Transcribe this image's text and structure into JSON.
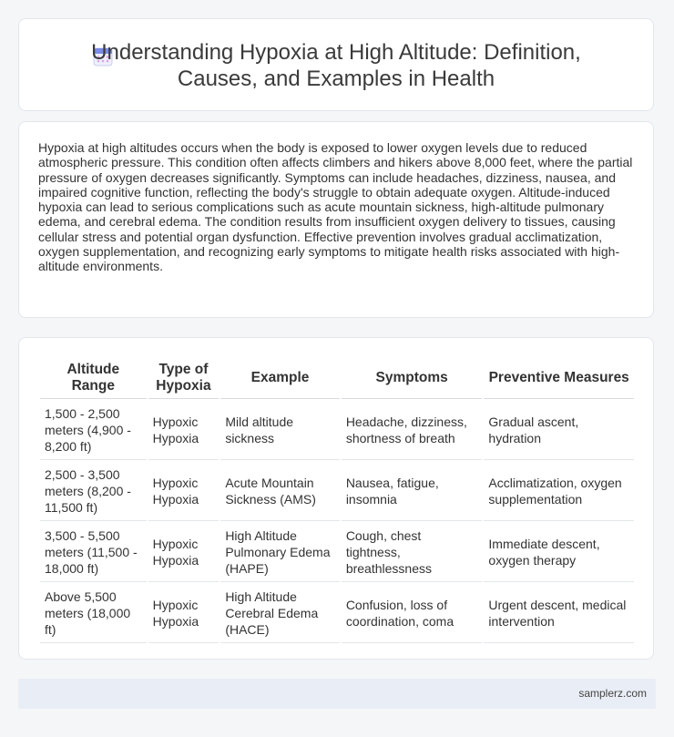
{
  "header": {
    "icon": "calendar-icon",
    "title": "Understanding Hypoxia at High Altitude: Definition, Causes, and Examples in Health"
  },
  "intro": {
    "text": "Hypoxia at high altitudes occurs when the body is exposed to lower oxygen levels due to reduced atmospheric pressure. This condition often affects climbers and hikers above 8,000 feet, where the partial pressure of oxygen decreases significantly. Symptoms can include headaches, dizziness, nausea, and impaired cognitive function, reflecting the body's struggle to obtain adequate oxygen. Altitude-induced hypoxia can lead to serious complications such as acute mountain sickness, high-altitude pulmonary edema, and cerebral edema. The condition results from insufficient oxygen delivery to tissues, causing cellular stress and potential organ dysfunction. Effective prevention involves gradual acclimatization, oxygen supplementation, and recognizing early symptoms to mitigate health risks associated with high-altitude environments."
  },
  "table": {
    "headers": [
      "Altitude Range",
      "Type of Hypoxia",
      "Example",
      "Symptoms",
      "Preventive Measures"
    ],
    "rows": [
      [
        "1,500 - 2,500 meters (4,900 - 8,200 ft)",
        "Hypoxic Hypoxia",
        "Mild altitude sickness",
        "Headache, dizziness, shortness of breath",
        "Gradual ascent, hydration"
      ],
      [
        "2,500 - 3,500 meters (8,200 - 11,500 ft)",
        "Hypoxic Hypoxia",
        "Acute Mountain Sickness (AMS)",
        "Nausea, fatigue, insomnia",
        "Acclimatization, oxygen supplementation"
      ],
      [
        "3,500 - 5,500 meters (11,500 - 18,000 ft)",
        "Hypoxic Hypoxia",
        "High Altitude Pulmonary Edema (HAPE)",
        "Cough, chest tightness, breathlessness",
        "Immediate descent, oxygen therapy"
      ],
      [
        "Above 5,500 meters (18,000 ft)",
        "Hypoxic Hypoxia",
        "High Altitude Cerebral Edema (HACE)",
        "Confusion, loss of coordination, coma",
        "Urgent descent, medical intervention"
      ]
    ]
  },
  "footer": {
    "site": "samplerz.com"
  }
}
